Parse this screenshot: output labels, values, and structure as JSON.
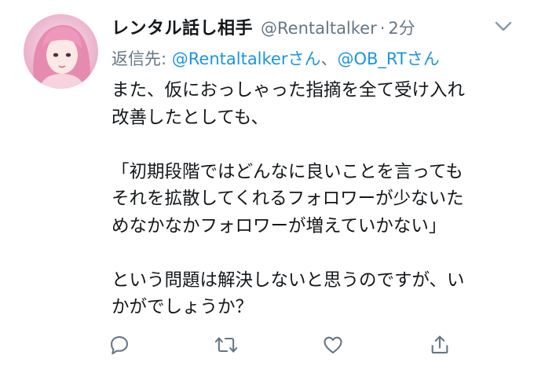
{
  "tweet": {
    "display_name": "レンタル話し相手",
    "handle": "@Rentaltalker",
    "separator": "·",
    "time": "2分",
    "reply_prefix": "返信先: ",
    "reply_mention_1": "@Rentaltalkerさん",
    "reply_joiner": "、",
    "reply_mention_2": "@OB_RTさん",
    "body": "また、仮におっしゃった指摘を全て受け入れ\n改善したとしても、\n\n「初期段階ではどんなに良いことを言っても\nそれを拡散してくれるフォロワーが少ないた\nめなかなかフォロワーが増えていかない」\n\nという問題は解決しないと思うのですが、い\nかがでしょうか？"
  },
  "icons": {
    "avatar": "avatar-photo",
    "menu": "chevron-down-icon",
    "reply": "reply-icon",
    "retweet": "retweet-icon",
    "like": "heart-icon",
    "share": "share-icon"
  },
  "colors": {
    "text": "#14171a",
    "secondary": "#657786",
    "link": "#1b95e0"
  }
}
